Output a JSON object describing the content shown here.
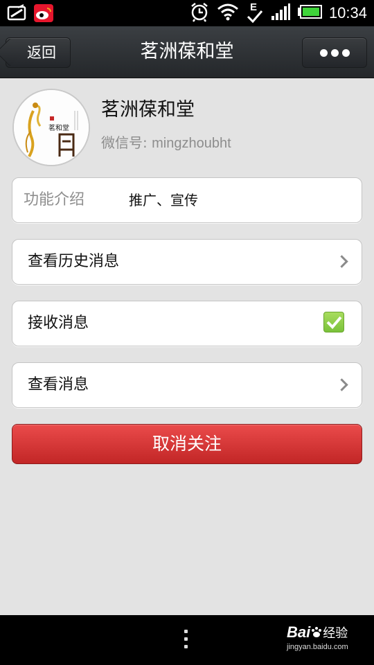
{
  "status_bar": {
    "time": "10:34",
    "network_type": "E",
    "icons": [
      "screenshot-icon",
      "weibo-icon",
      "alarm-icon",
      "wifi-icon",
      "network-e-icon",
      "signal-icon",
      "battery-icon"
    ]
  },
  "navbar": {
    "back_label": "返回",
    "title": "茗洲葆和堂",
    "more_icon": "more-dots-icon"
  },
  "profile": {
    "name": "茗洲葆和堂",
    "wechat_id_label": "微信号: ",
    "wechat_id": "mingzhoubht",
    "avatar_text": "茗和堂"
  },
  "intro": {
    "label": "功能介绍",
    "value": "推广、宣传"
  },
  "menu": {
    "history_label": "查看历史消息",
    "receive_label": "接收消息",
    "receive_checked": true,
    "view_label": "查看消息"
  },
  "actions": {
    "unfollow_label": "取消关注"
  },
  "colors": {
    "accent_red": "#d63636",
    "check_green": "#8dcf48",
    "background": "#e3e3e3"
  },
  "watermark": {
    "logo": "Bai",
    "logo_suffix": "经验",
    "site": "jingyan.baidu.com"
  }
}
